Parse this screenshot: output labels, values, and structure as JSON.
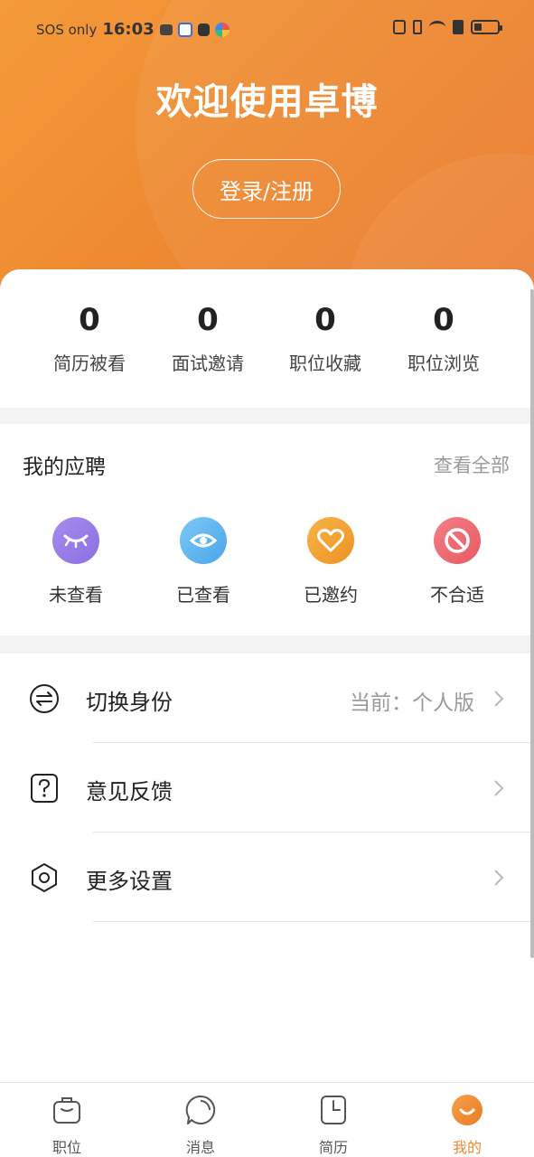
{
  "status_bar": {
    "carrier": "SOS only",
    "time": "16:03"
  },
  "header": {
    "welcome": "欢迎使用卓博",
    "login_label": "登录/注册"
  },
  "stats": [
    {
      "value": "0",
      "label": "简历被看"
    },
    {
      "value": "0",
      "label": "面试邀请"
    },
    {
      "value": "0",
      "label": "职位收藏"
    },
    {
      "value": "0",
      "label": "职位浏览"
    }
  ],
  "applications": {
    "title": "我的应聘",
    "view_all": "查看全部",
    "items": [
      {
        "label": "未查看",
        "icon": "closed-eye-icon",
        "color": "#9a80e6"
      },
      {
        "label": "已查看",
        "icon": "eye-icon",
        "color": "#5ab4ee"
      },
      {
        "label": "已邀约",
        "icon": "heart-icon",
        "color": "#f2a331"
      },
      {
        "label": "不合适",
        "icon": "forbidden-icon",
        "color": "#ee6b73"
      }
    ]
  },
  "menu": [
    {
      "label": "切换身份",
      "value": "当前：个人版",
      "icon": "switch-icon"
    },
    {
      "label": "意见反馈",
      "value": "",
      "icon": "question-icon"
    },
    {
      "label": "更多设置",
      "value": "",
      "icon": "settings-hexagon-icon"
    }
  ],
  "tabs": [
    {
      "label": "职位",
      "icon": "briefcase-icon",
      "active": false
    },
    {
      "label": "消息",
      "icon": "chat-bubble-icon",
      "active": false
    },
    {
      "label": "简历",
      "icon": "resume-icon",
      "active": false
    },
    {
      "label": "我的",
      "icon": "profile-smile-icon",
      "active": true
    }
  ],
  "colors": {
    "brand": "#ee8a31",
    "tab_active": "#ee8a31"
  }
}
